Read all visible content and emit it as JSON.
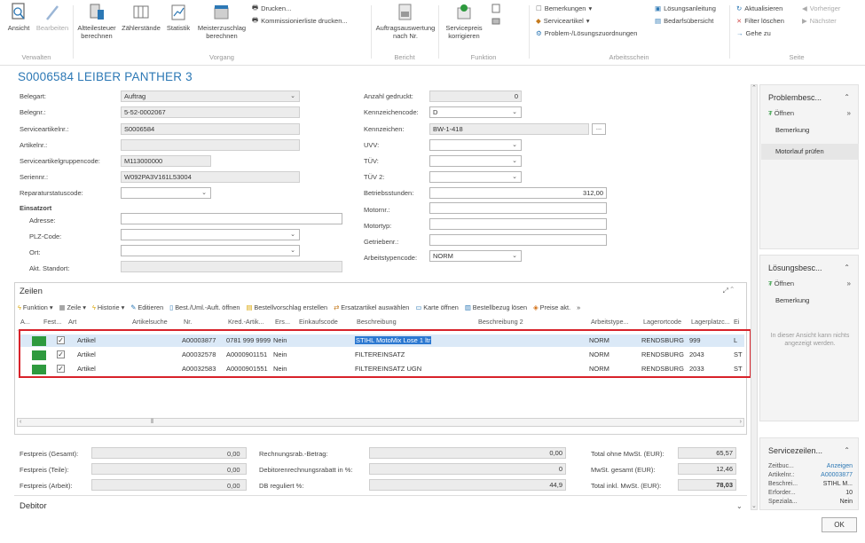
{
  "ribbon": {
    "verwalten": {
      "label": "Verwalten",
      "ansicht": "Ansicht",
      "bearbeiten": "Bearbeiten"
    },
    "vorgang": {
      "label": "Vorgang",
      "altteilesteuer": "Altteilesteuer berechnen",
      "zaehlerstaende": "Zählerstände",
      "statistik": "Statistik",
      "meisterzuschlag": "Meisterzuschlag berechnen",
      "drucken": "Drucken...",
      "kommissionierliste": "Kommissionierliste drucken..."
    },
    "bericht": {
      "label": "Bericht",
      "auftragsauswertung": "Auftragsauswertung nach Nr."
    },
    "funktion": {
      "label": "Funktion",
      "servicepreis": "Servicepreis korrigieren"
    },
    "arbeitsschein": {
      "label": "Arbeitsschein",
      "bemerkungen": "Bemerkungen",
      "serviceartikel": "Serviceartikel",
      "problem": "Problem-/Lösungszuordnungen",
      "loesungsanleitung": "Lösungsanleitung",
      "bedarfsuebersicht": "Bedarfsübersicht"
    },
    "seite": {
      "label": "Seite",
      "aktualisieren": "Aktualisieren",
      "vorheriger": "Vorheriger",
      "filter_loeschen": "Filter löschen",
      "naechster": "Nächster",
      "gehe_zu": "Gehe zu"
    }
  },
  "title": "S0006584 LEIBER PANTHER 3",
  "left_form": {
    "belegart": {
      "label": "Belegart:",
      "value": "Auftrag"
    },
    "belegnr": {
      "label": "Belegnr.:",
      "value": "5-52-0002067"
    },
    "serviceartikelnr": {
      "label": "Serviceartikelnr.:",
      "value": "S0006584"
    },
    "artikelnr": {
      "label": "Artikelnr.:",
      "value": ""
    },
    "serviceartikelgruppencode": {
      "label": "Serviceartikelgruppencode:",
      "value": "M113000000"
    },
    "seriennr": {
      "label": "Seriennr.:",
      "value": "W092PA3V161L53004"
    },
    "reparaturstatuscode": {
      "label": "Reparaturstatuscode:",
      "value": ""
    },
    "einsatzort": "Einsatzort",
    "adresse": {
      "label": "Adresse:",
      "value": ""
    },
    "plz": {
      "label": "PLZ-Code:",
      "value": ""
    },
    "ort": {
      "label": "Ort:",
      "value": ""
    },
    "standort": {
      "label": "Akt. Standort:",
      "value": ""
    }
  },
  "right_form": {
    "anzahl_gedruckt": {
      "label": "Anzahl gedruckt:",
      "value": "0"
    },
    "kennzeichencode": {
      "label": "Kennzeichencode:",
      "value": "D"
    },
    "kennzeichen": {
      "label": "Kennzeichen:",
      "value": "BW-1-418",
      "button": "..."
    },
    "uvv": {
      "label": "UVV:",
      "value": ""
    },
    "tuev": {
      "label": "TÜV:",
      "value": ""
    },
    "tuev2": {
      "label": "TÜV 2:",
      "value": ""
    },
    "betriebsstunden": {
      "label": "Betriebsstunden:",
      "value": "312,00"
    },
    "motornr": {
      "label": "Motornr.:",
      "value": ""
    },
    "motortyp": {
      "label": "Motortyp:",
      "value": ""
    },
    "getriebenr": {
      "label": "Getriebenr.:",
      "value": ""
    },
    "arbeitstypencode": {
      "label": "Arbeitstypencode:",
      "value": "NORM"
    }
  },
  "zeilen": {
    "title": "Zeilen",
    "toolbar": [
      "Funktion",
      "Zeile",
      "Historie",
      "Editieren",
      "Best./Uml.-Auft. öffnen",
      "Bestellvorschlag erstellen",
      "Ersatzartikel auswählen",
      "Karte öffnen",
      "Bestellbezug lösen",
      "Preise akt."
    ],
    "columns": [
      "A...",
      "Fest...",
      "Art",
      "Artikelsuche",
      "Nr.",
      "Kred.-Artik...",
      "Ers...",
      "Einkaufscode",
      "Beschreibung",
      "Beschreibung 2",
      "Arbeitstype...",
      "Lagerortcode",
      "Lagerplatzc...",
      "Ei"
    ],
    "rows": [
      {
        "art": "Artikel",
        "nr": "A00003877",
        "kred": "0781 999 9999",
        "ers": "Nein",
        "beschreibung": "STIHL MotoMix Lose 1 ltr",
        "arbeitstyp": "NORM",
        "lager": "RENDSBURG",
        "platz": "999",
        "ei": "L"
      },
      {
        "art": "Artikel",
        "nr": "A00032578",
        "kred": "A0000901151",
        "ers": "Nein",
        "beschreibung": "FILTEREINSATZ",
        "arbeitstyp": "NORM",
        "lager": "RENDSBURG",
        "platz": "2043",
        "ei": "ST"
      },
      {
        "art": "Artikel",
        "nr": "A00032583",
        "kred": "A0000901551",
        "ers": "Nein",
        "beschreibung": "FILTEREINSATZ UGN",
        "arbeitstyp": "NORM",
        "lager": "RENDSBURG",
        "platz": "2033",
        "ei": "ST"
      }
    ]
  },
  "totals": {
    "festpreis_gesamt": "Festpreis (Gesamt):",
    "festpreis_teile": "Festpreis (Teile):",
    "festpreis_arbeit": "Festpreis (Arbeit):",
    "rechnungsrab": {
      "label": "Rechnungsrab.-Betrag:",
      "value": "0,00",
      "right": "0,00"
    },
    "debitorenrab": {
      "label": "Debitorenrechnungsrabatt in %:",
      "value": "0,00",
      "right": "0"
    },
    "db_reguliert": {
      "label": "DB reguliert %:",
      "value": "0,00",
      "right": "44,9"
    },
    "total_ohne": {
      "label": "Total ohne MwSt. (EUR):",
      "value": "65,57"
    },
    "mwst": {
      "label": "MwSt. gesamt (EUR):",
      "value": "12,46"
    },
    "total_inkl": {
      "label": "Total inkl. MwSt. (EUR):",
      "value": "78,03"
    },
    "debitor": "Debitor"
  },
  "factbox1": {
    "title": "Problembesc...",
    "open": "Öffnen",
    "items": [
      "Bemerkung",
      "Motorlauf prüfen"
    ]
  },
  "factbox2": {
    "title": "Lösungsbesc...",
    "open": "Öffnen",
    "items": [
      "Bemerkung"
    ],
    "note": "In dieser Ansicht kann nichts angezeigt werden."
  },
  "factbox3": {
    "title": "Servicezeilen...",
    "rows": [
      {
        "label": "Zeitbuc...",
        "value": "Anzeigen"
      },
      {
        "label": "Artikelnr.:",
        "value": "A00003877"
      },
      {
        "label": "Beschrei...",
        "value": "STIHL M..."
      },
      {
        "label": "Erforder...",
        "value": "10"
      },
      {
        "label": "Speziala...",
        "value": "Nein"
      }
    ]
  },
  "ok": "OK",
  "colors": {
    "accent": "#2c78b5",
    "highlight": "#d8222a",
    "green": "#2e9a3e"
  }
}
